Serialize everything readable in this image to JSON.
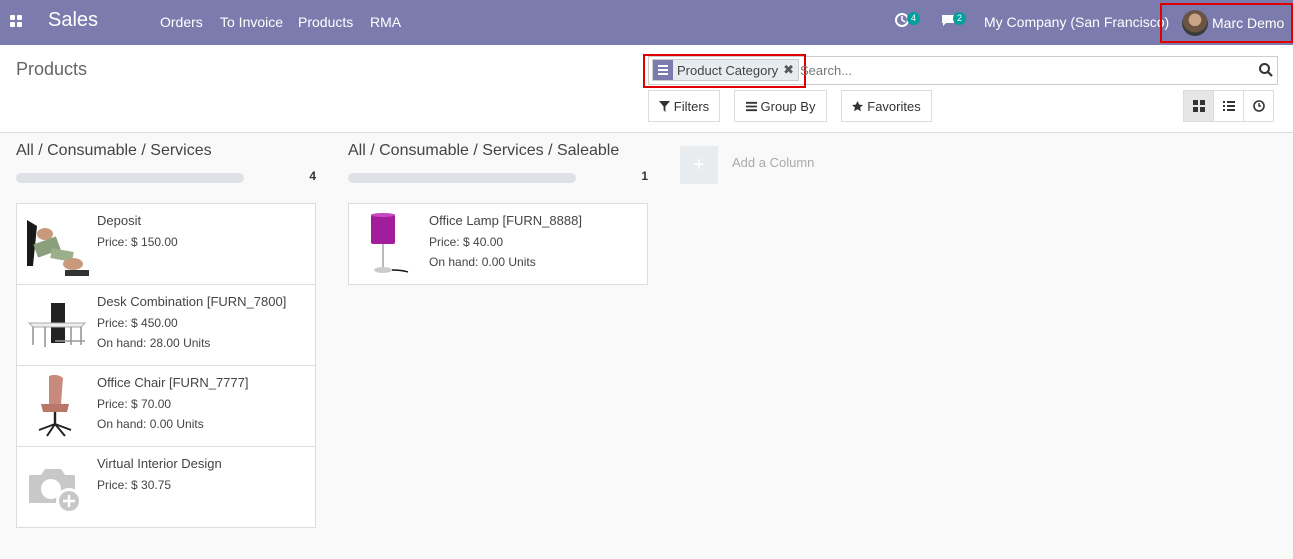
{
  "navbar": {
    "app_name": "Sales",
    "menu": [
      {
        "label": "Orders"
      },
      {
        "label": "To Invoice"
      },
      {
        "label": "Products"
      },
      {
        "label": "RMA"
      }
    ],
    "activity_count": "4",
    "message_count": "2",
    "company": "My Company (San Francisco)",
    "user_name": "Marc Demo",
    "color": "#7c7bad"
  },
  "control_panel": {
    "breadcrumb": "Products",
    "facet_label": "Product Category",
    "search_placeholder": "Search...",
    "buttons": {
      "filters": "Filters",
      "group_by": "Group By",
      "favorites": "Favorites"
    },
    "views": [
      "kanban-icon",
      "list-icon",
      "activity-icon"
    ]
  },
  "kanban": {
    "columns": [
      {
        "title": "All / Consumable / Services",
        "count": "4",
        "cards": [
          {
            "name": "Deposit",
            "price": "Price: $ 150.00",
            "on_hand": "",
            "image": "money-image"
          },
          {
            "name": "Desk Combination [FURN_7800]",
            "price": "Price: $ 450.00",
            "on_hand": "On hand: 28.00 Units",
            "image": "desk-image"
          },
          {
            "name": "Office Chair [FURN_7777]",
            "price": "Price: $ 70.00",
            "on_hand": "On hand: 0.00 Units",
            "image": "chair-image"
          },
          {
            "name": "Virtual Interior Design",
            "price": "Price: $ 30.75",
            "on_hand": "",
            "image": "placeholder-camera-image"
          }
        ]
      },
      {
        "title": "All / Consumable / Services / Saleable",
        "count": "1",
        "cards": [
          {
            "name": "Office Lamp [FURN_8888]",
            "price": "Price: $ 40.00",
            "on_hand": "On hand: 0.00 Units",
            "image": "lamp-image"
          }
        ]
      }
    ],
    "add_column_label": "Add a Column"
  }
}
